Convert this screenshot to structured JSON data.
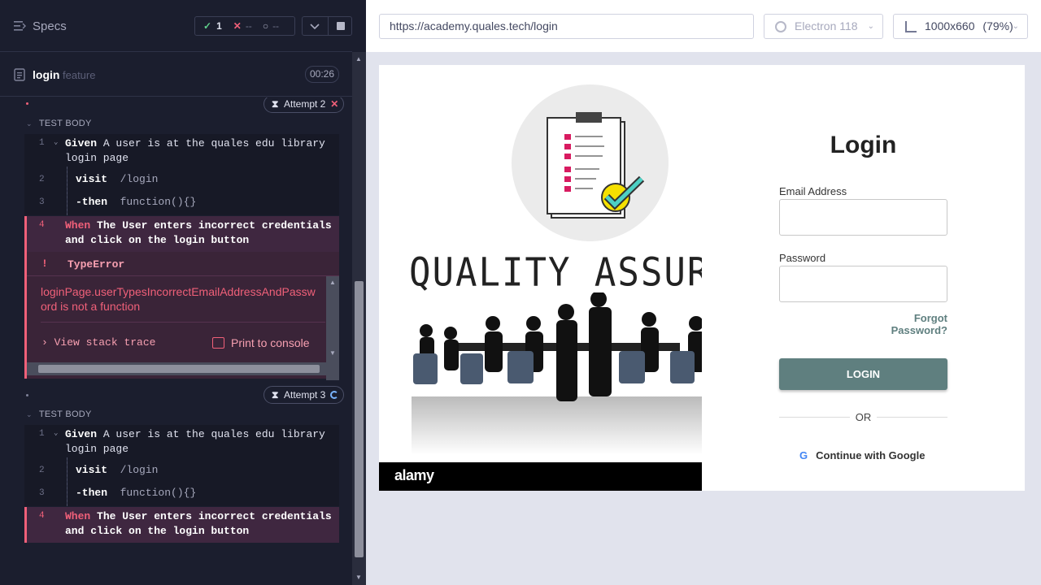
{
  "reporter": {
    "header": {
      "title": "Specs"
    },
    "stats": {
      "passed": "1",
      "failed": "--",
      "pending": "--"
    },
    "spec": {
      "name": "login",
      "ext": "feature",
      "duration": "00:26"
    },
    "attempts": [
      {
        "label": "Attempt 2",
        "section": "TEST BODY",
        "commands": [
          {
            "num": "1",
            "keyword": "Given",
            "text": " A user is at the quales edu library\nlogin page"
          },
          {
            "num": "2",
            "keyword": "visit",
            "text": "/login"
          },
          {
            "num": "3",
            "keyword": "-then",
            "text": "function(){}"
          },
          {
            "num": "4",
            "keyword": "When",
            "text": " The User enters incorrect credentials\nand click on the login button"
          }
        ],
        "error": {
          "bang": "!",
          "type": "TypeError",
          "message": "loginPage.userTypesIncorrectEmailAddressAndPassword is not a function",
          "stack_link": "View stack trace",
          "print_label": "Print to console"
        }
      },
      {
        "label": "Attempt 3",
        "section": "TEST BODY",
        "commands": [
          {
            "num": "1",
            "keyword": "Given",
            "text": " A user is at the quales edu library\nlogin page"
          },
          {
            "num": "2",
            "keyword": "visit",
            "text": "/login"
          },
          {
            "num": "3",
            "keyword": "-then",
            "text": "function(){}"
          },
          {
            "num": "4",
            "keyword": "When",
            "text": " The User enters incorrect credentials\nand click on the login button"
          }
        ]
      }
    ]
  },
  "browser": {
    "url": "https://academy.quales.tech/login",
    "name": "Electron 118",
    "viewport": "1000x660",
    "zoom": "(79%)"
  },
  "app": {
    "hero_text": "QUALITY ASSURA",
    "watermark": "alamy",
    "login": {
      "title": "Login",
      "email_label": "Email Address",
      "password_label": "Password",
      "forgot": "Forgot Password?",
      "button": "LOGIN",
      "or": "OR",
      "google": "Continue with Google"
    }
  },
  "colors": {
    "reporter_bg": "#1b1e2e",
    "error_red": "#f06079",
    "pass_green": "#5fcf8b",
    "login_button": "#5f7f7f"
  }
}
